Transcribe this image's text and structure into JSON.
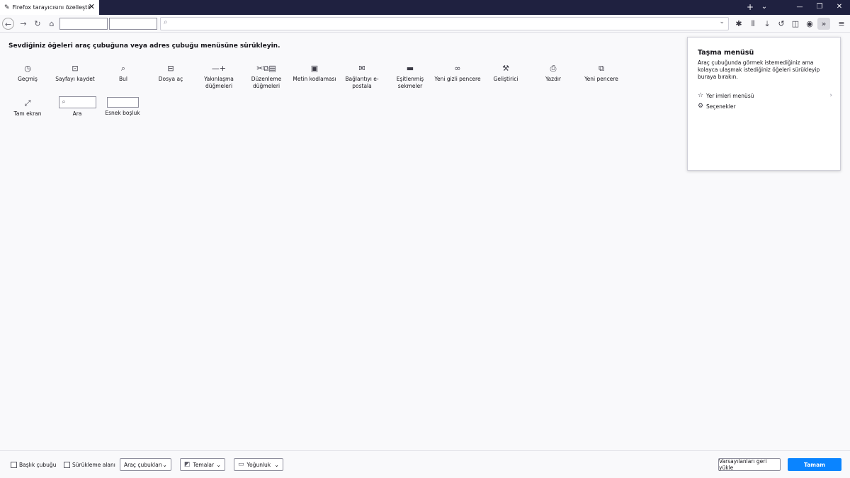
{
  "tab": {
    "icon": "paintbrush-icon",
    "title": "Firefox tarayıcısını özelleştir",
    "close_glyph": "✕"
  },
  "tabstrip": {
    "new_tab_glyph": "+",
    "list_tabs_glyph": "⌄",
    "minimize_glyph": "—",
    "restore_glyph": "❐",
    "close_glyph": "✕"
  },
  "nav": {
    "back_glyph": "←",
    "forward_glyph": "→",
    "reload_glyph": "↻",
    "home_glyph": "⌂",
    "search_glyph": "⌕",
    "dropdown_glyph": "⌄",
    "toolbar_icons": [
      "extensions-icon",
      "library-icon",
      "downloads-icon",
      "history-icon",
      "sidebar-icon",
      "account-icon",
      "overflow-icon",
      "menu-icon"
    ]
  },
  "instruction": "Sevdiğiniz öğeleri araç çubuğuna veya adres çubuğu menüsüne sürükleyin.",
  "palette": [
    {
      "label": "Geçmiş",
      "icon": "history-icon",
      "glyph": "◷"
    },
    {
      "label": "Sayfayı kaydet",
      "icon": "save-page-icon",
      "glyph": "⊡"
    },
    {
      "label": "Bul",
      "icon": "find-icon",
      "glyph": "⌕"
    },
    {
      "label": "Dosya aç",
      "icon": "open-file-icon",
      "glyph": "⊟"
    },
    {
      "label": "Yakınlaşma düğmeleri",
      "icon": "zoom-icon",
      "glyph": "—+"
    },
    {
      "label": "Düzenleme düğmeleri",
      "icon": "edit-icon",
      "glyph": "✂⧉▤"
    },
    {
      "label": "Metin kodlaması",
      "icon": "text-encoding-icon",
      "glyph": "▣"
    },
    {
      "label": "Bağlantıyı e-postala",
      "icon": "email-link-icon",
      "glyph": "✉"
    },
    {
      "label": "Eşitlenmiş sekmeler",
      "icon": "synced-tabs-icon",
      "glyph": "▬"
    },
    {
      "label": "Yeni gizli pencere",
      "icon": "private-window-icon",
      "glyph": "∞"
    },
    {
      "label": "Geliştirici",
      "icon": "developer-icon",
      "glyph": "🔧"
    },
    {
      "label": "Yazdır",
      "icon": "print-icon",
      "glyph": "⎙"
    },
    {
      "label": "Yeni pencere",
      "icon": "new-window-icon",
      "glyph": "⧉"
    },
    {
      "label": "Tam ekran",
      "icon": "fullscreen-icon",
      "glyph": "⤢"
    },
    {
      "label": "Ara",
      "icon": "search-icon",
      "glyph": "⌕"
    },
    {
      "label": "Esnek boşluk",
      "icon": "flexible-space-icon",
      "glyph": ""
    }
  ],
  "overflow_panel": {
    "title": "Taşma menüsü",
    "description": "Araç çubuğunda görmek istemediğiniz ama kolayca ulaşmak istediğiniz öğeleri sürükleyip buraya bırakın.",
    "items": [
      {
        "label": "Yer imleri menüsü",
        "icon": "bookmarks-menu-icon",
        "glyph": "☆",
        "arrow": "›"
      },
      {
        "label": "Seçenekler",
        "icon": "settings-icon",
        "glyph": "⚙",
        "arrow": ""
      }
    ]
  },
  "footer": {
    "title_bar_label": "Başlık çubuğu",
    "drag_space_label": "Sürükleme alanı",
    "toolbars_label": "Araç çubukları",
    "themes_label": "Temalar",
    "density_label": "Yoğunluk",
    "restore_defaults_label": "Varsayılanları geri yükle",
    "done_label": "Tamam",
    "chevron_glyph": "⌄",
    "accent": "#0a84ff"
  }
}
